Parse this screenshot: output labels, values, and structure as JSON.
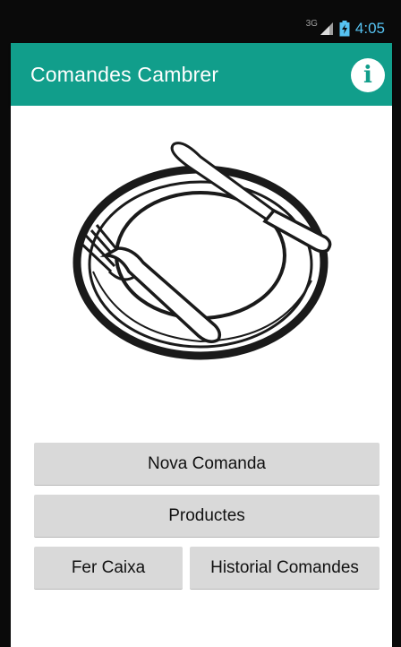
{
  "status_bar": {
    "network_type": "3G",
    "time": "4:05",
    "signal_icon": "signal-icon",
    "battery_icon": "battery-charging-icon",
    "accent_color": "#56c3f2"
  },
  "app_bar": {
    "title": "Comandes Cambrer",
    "info_icon": "info-icon",
    "info_glyph": "i",
    "color": "#119e8b"
  },
  "main": {
    "illustration": "plate-with-fork-and-knife",
    "buttons": {
      "nova_comanda": "Nova Comanda",
      "productes": "Productes",
      "fer_caixa": "Fer Caixa",
      "historial_comandes": "Historial Comandes"
    }
  }
}
